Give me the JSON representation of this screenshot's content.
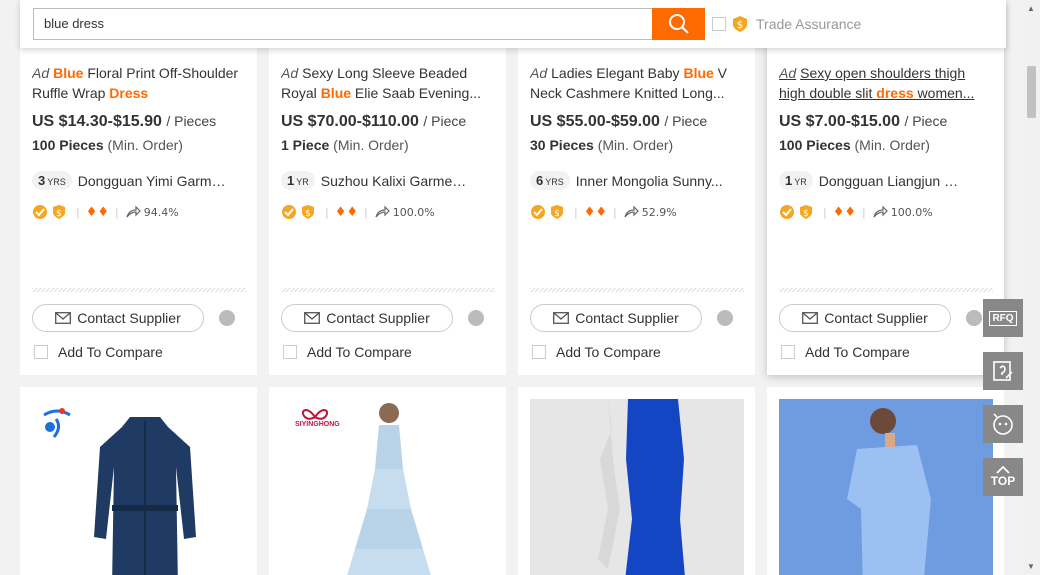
{
  "search": {
    "query": "blue dress",
    "trade_assurance_label": "Trade Assurance"
  },
  "products": [
    {
      "title_parts": [
        {
          "text": "Ad",
          "style": "ad"
        },
        {
          "text": "Blue",
          "style": "hl"
        },
        {
          "text": " Floral Print Off-Shoulder Ruffle Wrap ",
          "style": "plain"
        },
        {
          "text": "Dress",
          "style": "hl"
        }
      ],
      "price": "US $14.30-$15.90",
      "price_unit": "/ Pieces",
      "moq_qty": "100 Pieces",
      "moq_label": "(Min. Order)",
      "years": "3",
      "years_unit": "YRS",
      "supplier": "Dongguan Yimi Garme...",
      "response_rate": "94.4%",
      "contact_label": "Contact Supplier",
      "compare_label": "Add To Compare"
    },
    {
      "title_parts": [
        {
          "text": "Ad",
          "style": "ad"
        },
        {
          "text": "Sexy Long Sleeve Beaded Royal ",
          "style": "plain"
        },
        {
          "text": "Blue",
          "style": "hl"
        },
        {
          "text": " Elie Saab Evening...",
          "style": "plain"
        }
      ],
      "price": "US $70.00-$110.00",
      "price_unit": "/ Piece",
      "moq_qty": "1 Piece",
      "moq_label": "(Min. Order)",
      "years": "1",
      "years_unit": "YR",
      "supplier": "Suzhou Kalixi Garment...",
      "response_rate": "100.0%",
      "contact_label": "Contact Supplier",
      "compare_label": "Add To Compare"
    },
    {
      "title_parts": [
        {
          "text": "Ad",
          "style": "ad"
        },
        {
          "text": "Ladies Elegant Baby ",
          "style": "plain"
        },
        {
          "text": "Blue",
          "style": "hl"
        },
        {
          "text": " V Neck Cashmere Knitted Long...",
          "style": "plain"
        }
      ],
      "price": "US $55.00-$59.00",
      "price_unit": "/ Piece",
      "moq_qty": "30 Pieces",
      "moq_label": "(Min. Order)",
      "years": "6",
      "years_unit": "YRS",
      "supplier": "Inner Mongolia Sunny...",
      "response_rate": "52.9%",
      "contact_label": "Contact Supplier",
      "compare_label": "Add To Compare"
    },
    {
      "title_parts": [
        {
          "text": "Ad",
          "style": "ad"
        },
        {
          "text": "Sexy open shoulders thigh high double slit ",
          "style": "plain"
        },
        {
          "text": "dress",
          "style": "hl"
        },
        {
          "text": " women...",
          "style": "plain"
        }
      ],
      "price": "US $7.00-$15.00",
      "price_unit": "/ Piece",
      "moq_qty": "100 Pieces",
      "moq_label": "(Min. Order)",
      "years": "1",
      "years_unit": "YR",
      "supplier": "Dongguan Liangjun Gar...",
      "response_rate": "100.0%",
      "contact_label": "Contact Supplier",
      "compare_label": "Add To Compare"
    }
  ],
  "bottom_row": [
    {
      "image": "denim-shirt-dress",
      "logo": "supplier-logo-blue"
    },
    {
      "image": "light-blue-tiered-gown",
      "logo": "siyinghong-logo",
      "logo_text": "SIYINGHONG"
    },
    {
      "image": "royal-blue-knit-dress-on-mannequin"
    },
    {
      "image": "blue-off-shoulder-shirt-dress"
    }
  ],
  "rail": {
    "rfq_label": "RFQ",
    "top_label": "TOP"
  },
  "colors": {
    "accent": "#ff6a00",
    "rail": "#888888"
  }
}
